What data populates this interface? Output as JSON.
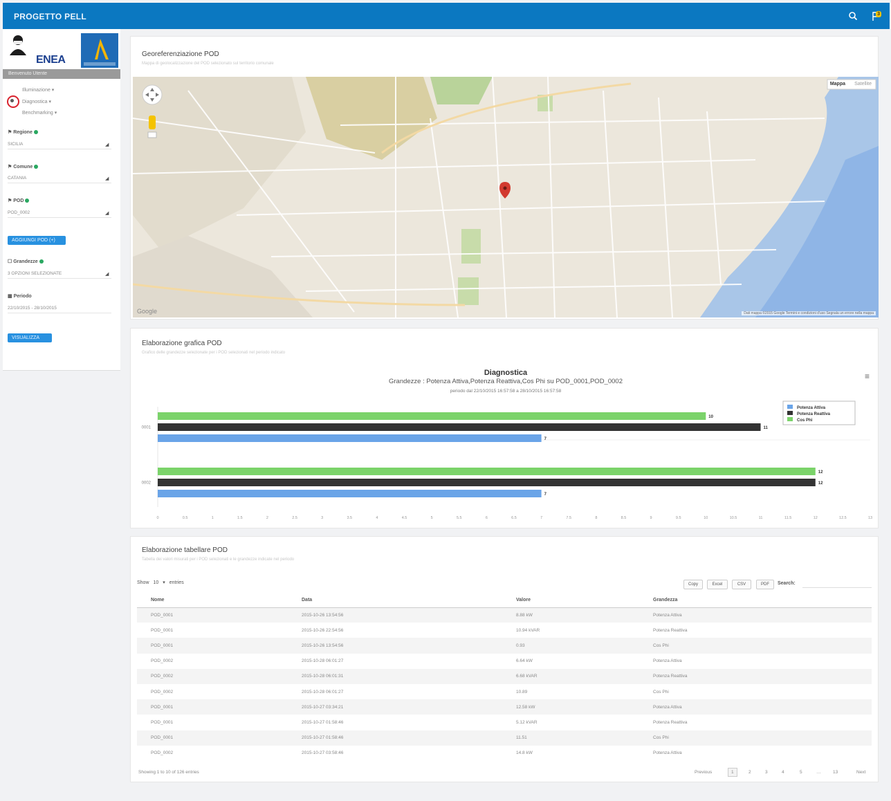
{
  "header": {
    "title": "PROGETTO PELL"
  },
  "notifications": {
    "count": "3"
  },
  "sidebar": {
    "logo_text": "ENEA",
    "logo_box_text": "ENEA",
    "user_label": "Benvenuto Utente",
    "nav": [
      {
        "label": "Illuminazione ▾"
      },
      {
        "label": "Diagnostica ▾"
      },
      {
        "label": "Benchmarking ▾"
      }
    ],
    "fields": [
      {
        "label": "Regione",
        "value": "SICILIA"
      },
      {
        "label": "Comune",
        "value": "CATANIA"
      },
      {
        "label": "POD",
        "value": "POD_0002"
      }
    ],
    "btn_select": "AGGIUNGI POD (+)",
    "grandezze": {
      "label": "Grandezze",
      "value": "3 OPZIONI SELEZIONATE"
    },
    "periodo": {
      "label": "Periodo",
      "value": "22/10/2015 - 28/10/2015"
    },
    "btn_visualizza": "VISUALIZZA"
  },
  "geo": {
    "title": "Georeferenziazione POD",
    "subtitle": "Mappa di geolocalizzazione del POD selezionato sul territorio comunale",
    "map_type": [
      "Mappa",
      "Satellite"
    ],
    "map_logo": "Google",
    "map_footer": "Dati mappa ©2015 Google   Termini e condizioni d'uso   Segnala un errore nella mappa"
  },
  "graph": {
    "title": "Elaborazione grafica POD",
    "subtitle": "Grafico delle grandezze selezionate per i POD selezionati nel periodo indicato"
  },
  "chart_data": {
    "type": "bar",
    "orientation": "horizontal",
    "title": "Diagnostica",
    "subtitle": "Grandezze : Potenza Attiva,Potenza Reattiva,Cos Phi su POD_0001,POD_0002",
    "period": "periodo dal 22/10/2015 16:57:58 a 28/10/2015 16:57:58",
    "categories": [
      "0001",
      "0002"
    ],
    "series": [
      {
        "name": "Cos Phi",
        "color": "#7bd36a",
        "values": [
          10,
          12
        ]
      },
      {
        "name": "Potenza Reattiva",
        "color": "#333333",
        "values": [
          11,
          12
        ]
      },
      {
        "name": "Potenza Attiva",
        "color": "#6aa4e8",
        "values": [
          7,
          7
        ]
      }
    ],
    "value_labels": [
      [
        "10",
        "11",
        "7"
      ],
      [
        "12",
        "12",
        "7"
      ]
    ],
    "xlim": [
      0,
      13
    ],
    "x_ticks": [
      "0",
      "0.5",
      "1",
      "1.5",
      "2",
      "2.5",
      "3",
      "3.5",
      "4",
      "4.5",
      "5",
      "5.5",
      "6",
      "6.5",
      "7",
      "7.5",
      "8",
      "8.5",
      "9",
      "9.5",
      "10",
      "10.5",
      "11",
      "11.5",
      "12",
      "12.5",
      "13"
    ],
    "legend_placement": "top-right",
    "legend": [
      "Potenza Attiva",
      "Potenza Reattiva",
      "Cos Phi"
    ]
  },
  "table_section": {
    "title": "Elaborazione tabellare POD",
    "subtitle": "Tabella dei valori misurati per i POD selezionati e le grandezze indicate nel periodo",
    "show_label": "Show",
    "show_value": "10",
    "entries_label": "entries",
    "buttons": [
      "Copy",
      "Excel",
      "CSV",
      "PDF"
    ],
    "search_label": "Search:",
    "columns": [
      "Nome",
      "Data",
      "Valore",
      "Grandezza"
    ],
    "rows": [
      [
        "POD_0001",
        "2015-10-26 13:54:56",
        "8.88 kW",
        "Potenza Attiva"
      ],
      [
        "POD_0001",
        "2015-10-26 22:54:56",
        "10.94 kVAR",
        "Potenza Reattiva"
      ],
      [
        "POD_0001",
        "2015-10-26 13:54:56",
        "0.93",
        "Cos Phi"
      ],
      [
        "POD_0002",
        "2015-10-28 06:01:27",
        "6.64 kW",
        "Potenza Attiva"
      ],
      [
        "POD_0002",
        "2015-10-28 06:01:31",
        "6.68 kVAR",
        "Potenza Reattiva"
      ],
      [
        "POD_0002",
        "2015-10-28 06:01:27",
        "10.89",
        "Cos Phi"
      ],
      [
        "POD_0001",
        "2015-10-27 03:34:21",
        "12.58 kW",
        "Potenza Attiva"
      ],
      [
        "POD_0001",
        "2015-10-27 01:58:46",
        "5.12 kVAR",
        "Potenza Reattiva"
      ],
      [
        "POD_0001",
        "2015-10-27 01:58:46",
        "11.51",
        "Cos Phi"
      ],
      [
        "POD_0002",
        "2015-10-27 03:58:46",
        "14.8 kW",
        "Potenza Attiva"
      ]
    ],
    "info": "Showing 1 to 10 of 126 entries",
    "pagination": [
      "Previous",
      "1",
      "2",
      "3",
      "4",
      "5",
      "…",
      "13",
      "Next"
    ]
  }
}
